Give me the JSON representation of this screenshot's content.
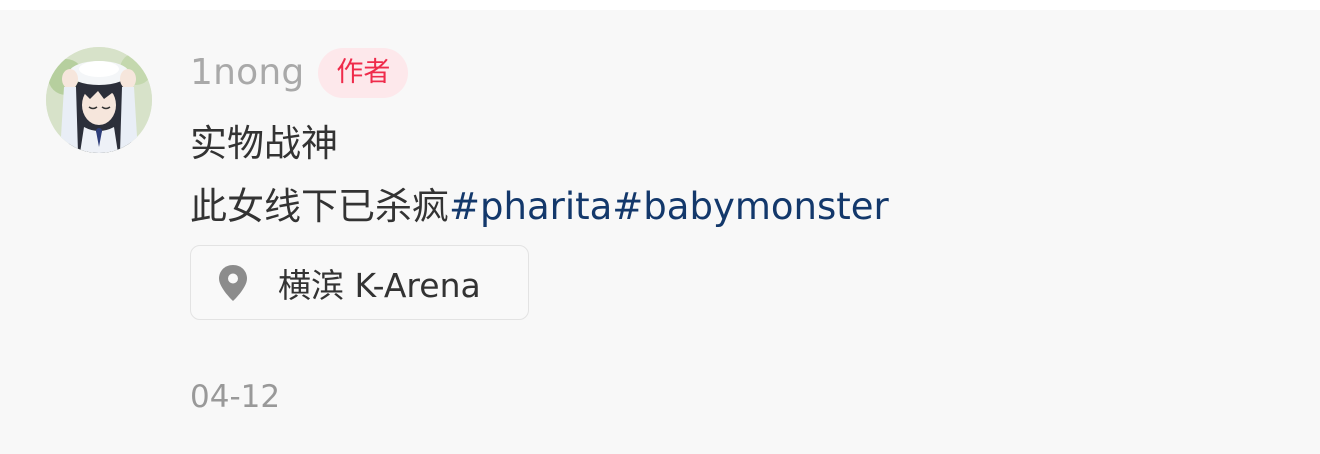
{
  "comment": {
    "author": {
      "name": "1nong",
      "badge": "作者"
    },
    "text_line1": "实物战神",
    "text_line2_plain": "此女线下已杀疯",
    "hashtags": [
      "#pharita",
      "#babymonster"
    ],
    "location": {
      "icon": "location-pin-icon",
      "name": "横滨 K-Arena"
    },
    "date": "04-12"
  },
  "colors": {
    "card_background": "#f8f8f8",
    "username": "#a9a9a9",
    "badge_background": "#fde8eb",
    "badge_text": "#ef2b4b",
    "body_text": "#333333",
    "hashtag": "#13386b",
    "date": "#999999"
  }
}
